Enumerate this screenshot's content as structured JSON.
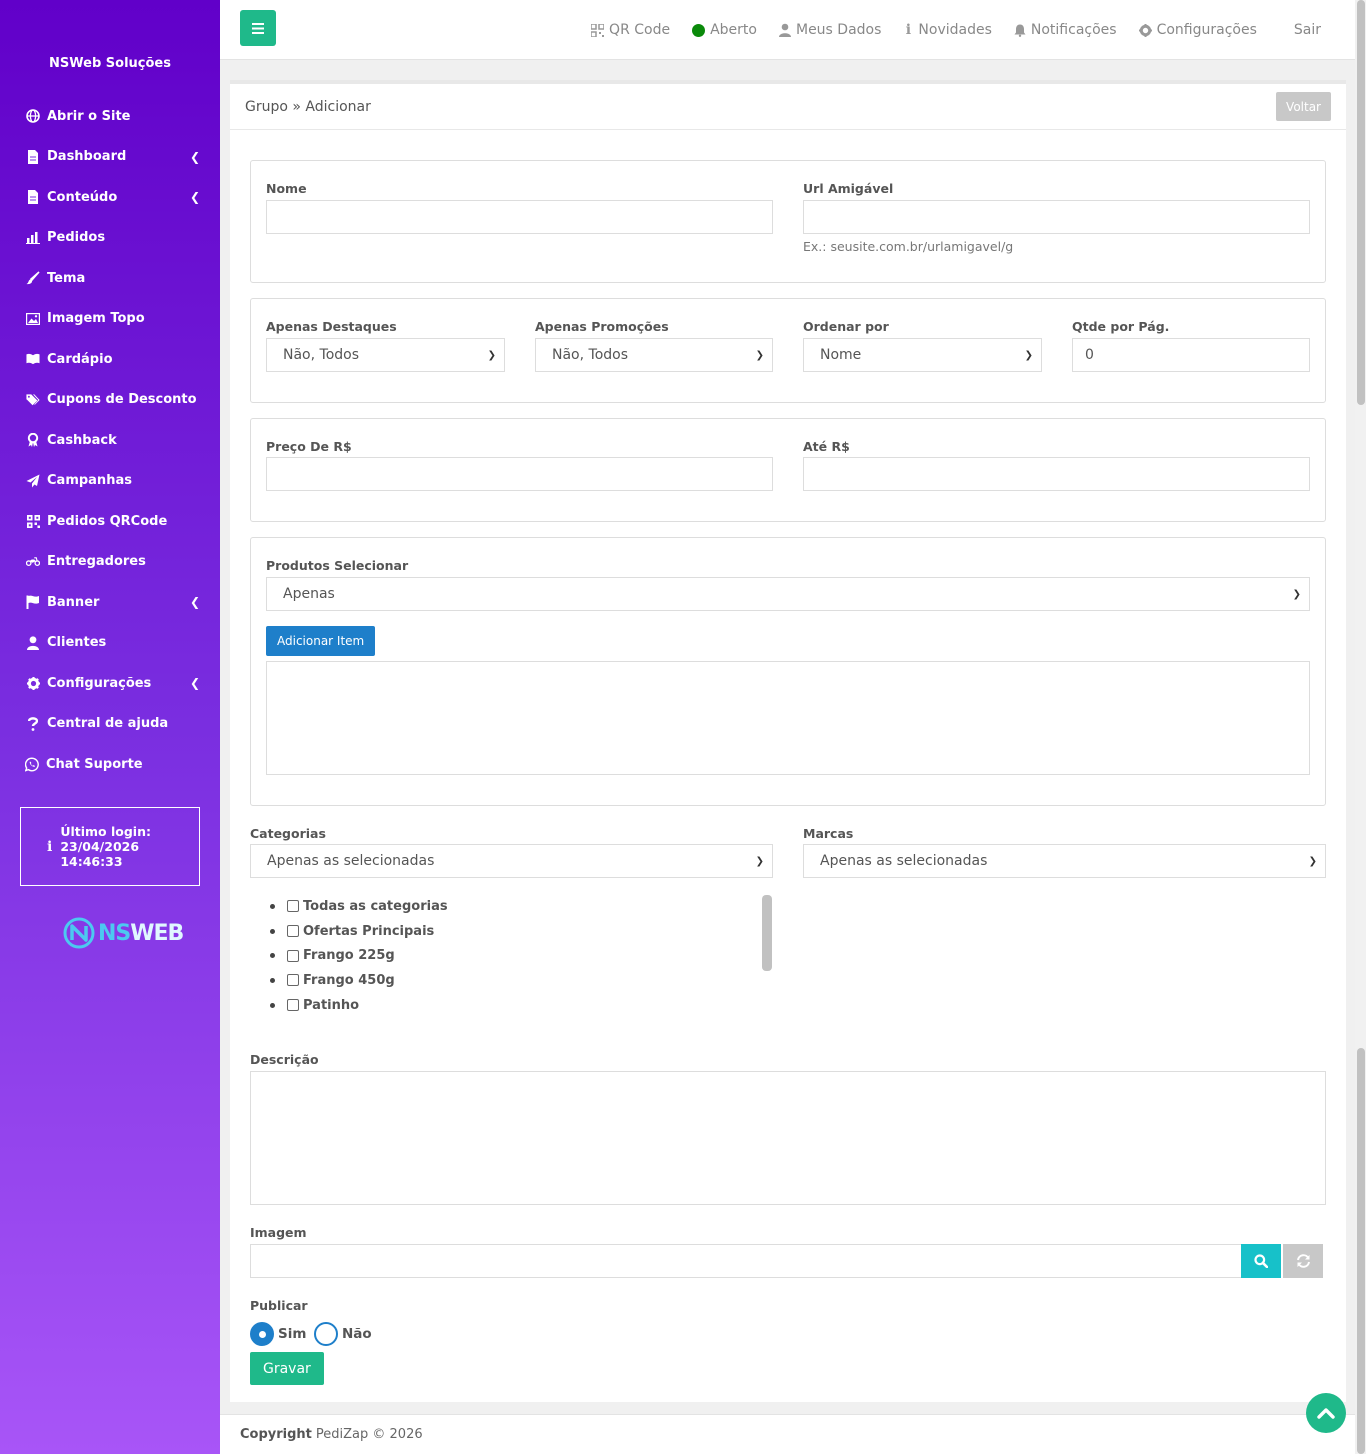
{
  "brand": "NSWeb Soluções",
  "sidebar": {
    "items": [
      {
        "label": "Abrir o Site",
        "icon": "globe-icon",
        "chevron": false
      },
      {
        "label": "Dashboard",
        "icon": "file-icon",
        "chevron": true
      },
      {
        "label": "Conteúdo",
        "icon": "file-icon",
        "chevron": true
      },
      {
        "label": "Pedidos",
        "icon": "chart-icon",
        "chevron": false
      },
      {
        "label": "Tema",
        "icon": "brush-icon",
        "chevron": false
      },
      {
        "label": "Imagem Topo",
        "icon": "image-icon",
        "chevron": false
      },
      {
        "label": "Cardápio",
        "icon": "book-icon",
        "chevron": false
      },
      {
        "label": "Cupons de Desconto",
        "icon": "tags-icon",
        "chevron": false
      },
      {
        "label": "Cashback",
        "icon": "award-icon",
        "chevron": false
      },
      {
        "label": "Campanhas",
        "icon": "paper-plane-icon",
        "chevron": false
      },
      {
        "label": "Pedidos QRCode",
        "icon": "qrcode-icon",
        "chevron": false
      },
      {
        "label": "Entregadores",
        "icon": "motorcycle-icon",
        "chevron": false
      },
      {
        "label": "Banner",
        "icon": "flag-icon",
        "chevron": true
      },
      {
        "label": "Clientes",
        "icon": "user-icon",
        "chevron": false
      },
      {
        "label": "Configurações",
        "icon": "gear-icon",
        "chevron": true
      },
      {
        "label": "Central de ajuda",
        "icon": "question-icon",
        "chevron": false
      },
      {
        "label": "Chat Suporte",
        "icon": "whatsapp-icon",
        "chevron": false
      }
    ],
    "login_label": "Último login:",
    "login_date": "23/04/2026",
    "login_time": "14:46:33",
    "logo_ns": "NS",
    "logo_web": "WEB"
  },
  "topbar": {
    "qr": "QR Code",
    "aberto": "Aberto",
    "meus_dados": "Meus Dados",
    "novidades": "Novidades",
    "notificacoes": "Notificações",
    "configuracoes": "Configurações",
    "sair": "Sair"
  },
  "panel": {
    "title": "Grupo » Adicionar",
    "voltar": "Voltar"
  },
  "form": {
    "nome_label": "Nome",
    "url_label": "Url Amigável",
    "url_help": "Ex.: seusite.com.br/urlamigavel/g",
    "destaques_label": "Apenas Destaques",
    "destaques_value": "Não, Todos",
    "promocoes_label": "Apenas Promoções",
    "promocoes_value": "Não, Todos",
    "ordenar_label": "Ordenar por",
    "ordenar_value": "Nome",
    "qtde_label": "Qtde por Pág.",
    "qtde_value": "0",
    "preco_de_label": "Preço De R$",
    "ate_label": "Até R$",
    "produtos_label": "Produtos Selecionar",
    "produtos_value": "Apenas",
    "adicionar_item": "Adicionar Item",
    "categorias_label": "Categorias",
    "categorias_value": "Apenas as selecionadas",
    "marcas_label": "Marcas",
    "marcas_value": "Apenas as selecionadas",
    "categories": [
      "Todas as categorias",
      "Ofertas Principais",
      "Frango 225g",
      "Frango 450g",
      "Patinho"
    ],
    "descricao_label": "Descrição",
    "imagem_label": "Imagem",
    "publicar_label": "Publicar",
    "sim": "Sim",
    "nao": "Não",
    "gravar": "Gravar"
  },
  "footer": {
    "copyright": "Copyright",
    "text": "PediZap © 2026"
  },
  "colors": {
    "sidebar_top": "#6100c9",
    "sidebar_bottom": "#a855f7",
    "accent_green": "#1fb98a",
    "accent_blue": "#1e7fca",
    "status_open": "#0a8a0a",
    "search_btn": "#17c1c9"
  }
}
